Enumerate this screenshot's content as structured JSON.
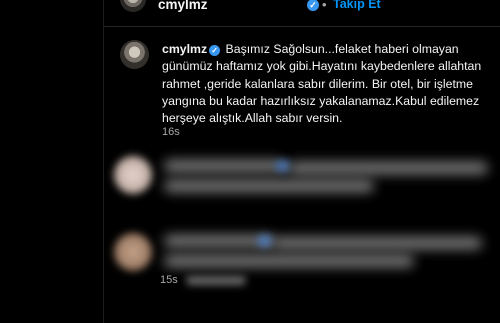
{
  "post_header": {
    "username": "cmylmz",
    "separator": "•",
    "follow_label": "Takip Et"
  },
  "caption": {
    "username": "cmylmz",
    "text": "Başımız Sağolsun...felaket haberi olmayan günümüz haftamız yok gibi.Hayatını kaybedenlere allahtan rahmet ,geride kalanlara sabır dilerim. Bir otel, bir işletme yangına bu kadar hazırlıksız yakalanamaz.Kabul edilemez herşeye alıştık.Allah sabır versin.",
    "time": "16s"
  },
  "comments": [
    {
      "time": ""
    },
    {
      "time": "15s"
    }
  ],
  "colors": {
    "background": "#000000",
    "text": "#f5f5f5",
    "muted": "#a8a8a8",
    "link": "#0095f6",
    "verified": "#3897f0"
  },
  "icons": {
    "verified": "verified-badge-icon"
  }
}
